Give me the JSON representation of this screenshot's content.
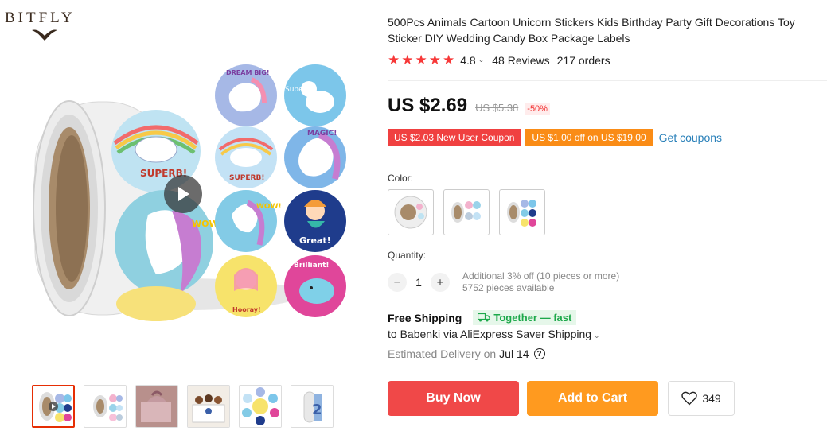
{
  "brand": {
    "name": "BITFLY"
  },
  "gallery": {
    "play_label": "",
    "thumbnails": [
      "thumb-1",
      "thumb-2",
      "thumb-3",
      "thumb-4",
      "thumb-5",
      "thumb-6"
    ],
    "sticker_texts": {
      "dream": "DREAM BIG!",
      "super": "Super!",
      "superb": "SUPERB!",
      "magic": "MAGIC!",
      "wow": "WOW!",
      "great": "Great!",
      "hooray": "Hooray!",
      "brilliant": "Brilliant!"
    }
  },
  "product": {
    "title": "500Pcs Animals Cartoon Unicorn Stickers Kids Birthday Party Gift Decorations Toy Sticker DIY Wedding Candy Box Package Labels",
    "rating": "4.8",
    "reviews": "48 Reviews",
    "orders": "217 orders"
  },
  "price": {
    "current": "US $2.69",
    "original": "US $5.38",
    "discount": "-50%"
  },
  "coupons": {
    "new_user": "US $2.03 New User Coupon",
    "store": "US $1.00 off on US $19.00",
    "get_label": "Get coupons"
  },
  "color": {
    "label": "Color:"
  },
  "quantity": {
    "label": "Quantity:",
    "minus": "−",
    "value": "1",
    "plus": "+",
    "note": "Additional 3% off (10 pieces or more)",
    "available": "5752 pieces available"
  },
  "shipping": {
    "free": "Free Shipping",
    "together": "Together — fast",
    "to": "to Babenki via AliExpress Saver Shipping",
    "delivery_label": "Estimated Delivery on",
    "delivery_date": "Jul 14"
  },
  "actions": {
    "buy": "Buy Now",
    "cart": "Add to Cart",
    "wish_count": "349"
  },
  "colors": {
    "price_red": "#f04040",
    "coupon_orange": "#fa8c16",
    "link_blue": "#2980b9",
    "fast_green": "#1ca84a"
  }
}
